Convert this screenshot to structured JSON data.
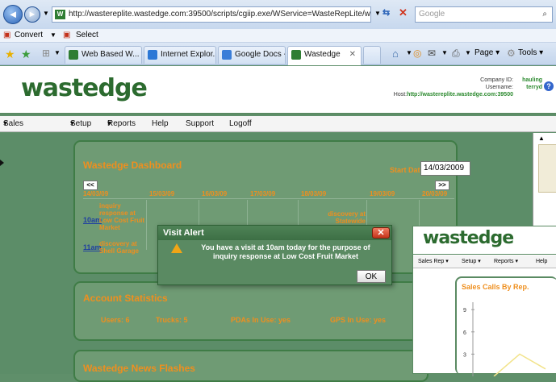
{
  "browser": {
    "url": "http://wastereplite.wastedge.com:39500/scripts/cgiip.exe/WService=WasteRepLite/we_genera",
    "search_placeholder": "Google",
    "convert_label": "Convert",
    "select_label": "Select",
    "tabs": [
      {
        "label": "Web Based W..."
      },
      {
        "label": "Internet Explor..."
      },
      {
        "label": "Google Docs -..."
      },
      {
        "label": "Wastedge"
      }
    ],
    "page_menu": "Page",
    "tools_menu": "Tools"
  },
  "app": {
    "logo": "wastedge",
    "company_label": "Company ID:",
    "company_value": "hauling",
    "username_label": "Username:",
    "username_value": "terryd",
    "host_label": "Host:",
    "host_value": "http://wastereplite.wastedge.com:39500",
    "menu": [
      "Sales Rep",
      "Setup",
      "Reports",
      "Help",
      "Support",
      "Logoff"
    ]
  },
  "dashboard": {
    "title": "Wastedge Dashboard",
    "start_date_label": "Start Date:",
    "start_date_value": "14/03/2009",
    "prev": "<<",
    "next": ">>",
    "dates": [
      "14/03/09",
      "15/03/09",
      "16/03/09",
      "17/03/09",
      "18/03/09",
      "19/03/09",
      "20/03/09"
    ],
    "events": [
      {
        "time": "10am",
        "text": "inquiry response at Low Cost Fruit Market"
      },
      {
        "time": "11am",
        "text": "discovery at Shell Garage"
      },
      {
        "time": "1300",
        "text": "discovery at Statewide"
      }
    ]
  },
  "stats": {
    "title": "Account Statistics",
    "users": "Users: 6",
    "trucks": "Trucks: 5",
    "pdas": "PDAs In Use: yes",
    "gps": "GPS In Use: yes"
  },
  "news": {
    "title": "Wastedge News Flashes"
  },
  "alert": {
    "title": "Visit Alert",
    "message": "You have a visit at 10am today for the purpose of inquiry response at Low Cost Fruit Market",
    "ok": "OK"
  },
  "second_window": {
    "logo": "wastedge",
    "menu": [
      "Sales Rep",
      "Setup",
      "Reports",
      "Help"
    ],
    "chart_title": "Sales Calls By Rep."
  },
  "chart_data": {
    "type": "line",
    "title": "Sales Calls By Rep.",
    "y_ticks": [
      9,
      6,
      3
    ],
    "ylim": [
      0,
      10
    ],
    "series": [
      {
        "values": [
          0,
          3,
          1
        ]
      }
    ]
  }
}
